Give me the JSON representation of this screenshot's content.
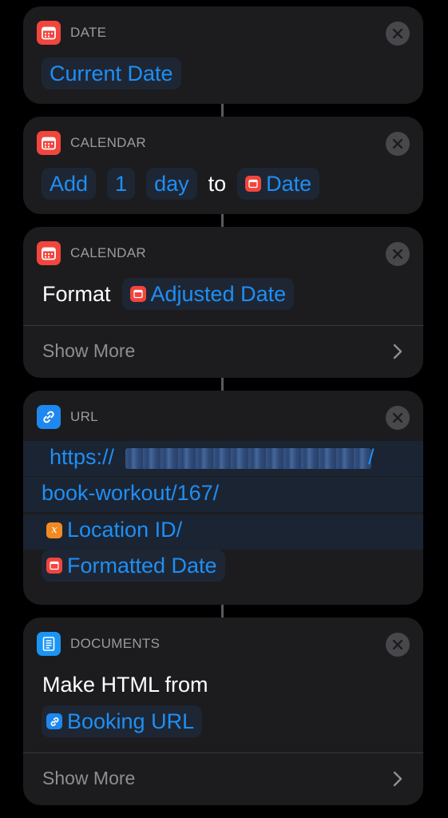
{
  "actions": [
    {
      "category": "DATE",
      "icon": "calendar-icon",
      "tokens": [
        "Current Date"
      ]
    },
    {
      "category": "CALENDAR",
      "icon": "calendar-icon",
      "parts": {
        "op": "Add",
        "amount": "1",
        "unit": "day",
        "to": "to",
        "target": "Date"
      }
    },
    {
      "category": "CALENDAR",
      "icon": "calendar-icon",
      "parts": {
        "verb": "Format",
        "variable": "Adjusted Date"
      },
      "show_more": "Show More"
    },
    {
      "category": "URL",
      "icon": "link-icon",
      "lines": {
        "line1_prefix": "https://",
        "line1_suffix": "/",
        "line2": "book-workout/167/",
        "line3_var": "Location ID",
        "line3_suffix": " /",
        "line4_var": "Formatted Date"
      }
    },
    {
      "category": "DOCUMENTS",
      "icon": "document-icon",
      "parts": {
        "verb": "Make HTML from",
        "variable": "Booking URL"
      },
      "show_more": "Show More"
    }
  ],
  "colors": {
    "background": "#000000",
    "card": "#1c1c1e",
    "accent_blue": "#1e8ff5",
    "calendar_red": "#f2453d",
    "variable_orange": "#f28a24",
    "label_gray": "#9a9aa0"
  }
}
